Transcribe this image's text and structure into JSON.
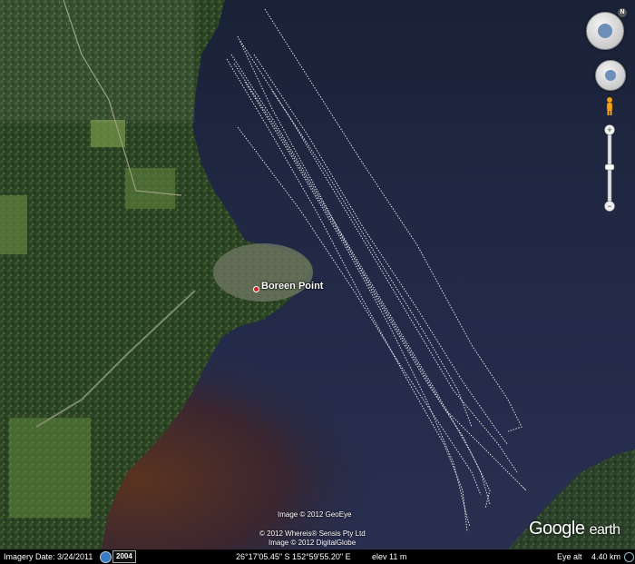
{
  "map": {
    "place_name": "Boreen Point",
    "water_color": "#1b2440",
    "land_color": "#2f4a24",
    "track_color": "#ffffff"
  },
  "attribution": {
    "line1": "Image © 2012 GeoEye",
    "line2": "© 2012 Whereis® Sensis Pty Ltd",
    "line3": "Image © 2012 DigitalGlobe"
  },
  "brand": {
    "google": "Google",
    "earth": "earth"
  },
  "navigation": {
    "north_label": "N"
  },
  "status_bar": {
    "imagery_date": "Imagery Date: 3/24/2011",
    "year": "2004",
    "coordinates": "26°17'05.45\" S 152°59'55.20\" E",
    "elevation": "elev    11 m",
    "eye_alt_label": "Eye alt",
    "eye_alt_value": "4.40 km"
  }
}
